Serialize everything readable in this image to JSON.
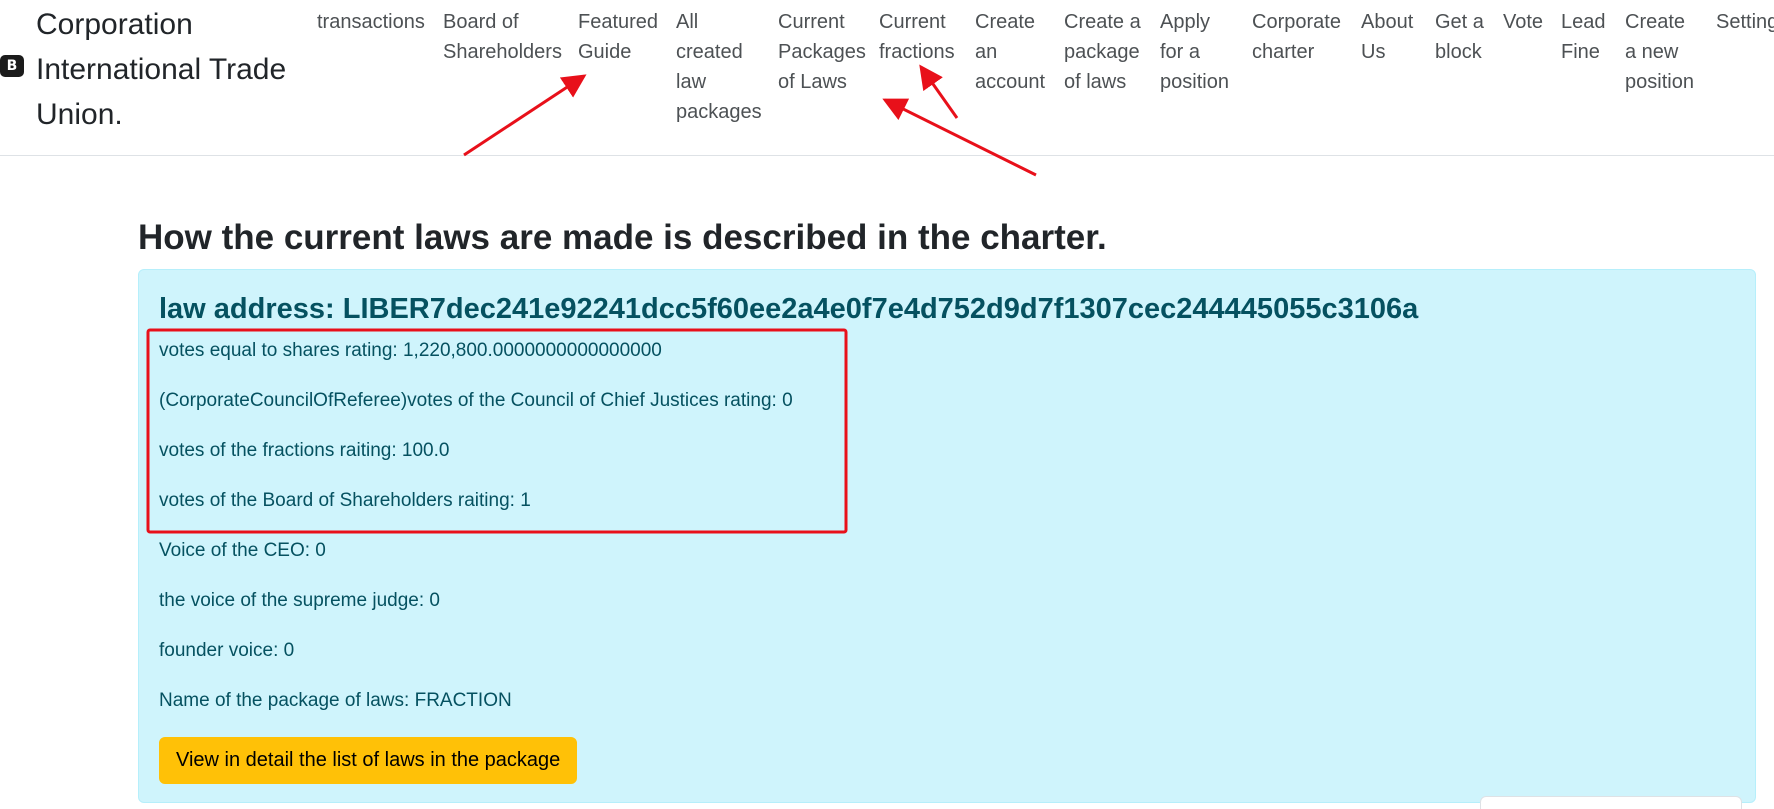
{
  "navbar": {
    "brand_icon": "B",
    "brand_line1": "Corporation",
    "brand_line2": "International Trade",
    "brand_line3": "Union.",
    "items": [
      {
        "lines": [
          "transactions"
        ]
      },
      {
        "lines": [
          "Board of",
          "Shareholders"
        ]
      },
      {
        "lines": [
          "Featured",
          "Guide"
        ]
      },
      {
        "lines": [
          "All",
          "created",
          "law",
          "packages"
        ]
      },
      {
        "lines": [
          "Current",
          "Packages",
          "of Laws"
        ]
      },
      {
        "lines": [
          "Current",
          "fractions"
        ]
      },
      {
        "lines": [
          "Create",
          "an",
          "account"
        ]
      },
      {
        "lines": [
          "Create a",
          "package",
          "of laws"
        ]
      },
      {
        "lines": [
          "Apply",
          "for a",
          "position"
        ]
      },
      {
        "lines": [
          "Corporate",
          "charter"
        ]
      },
      {
        "lines": [
          "About",
          "Us"
        ]
      },
      {
        "lines": [
          "Get a",
          "block"
        ]
      },
      {
        "lines": [
          "Vote"
        ]
      },
      {
        "lines": [
          "Lead",
          "Fine"
        ]
      },
      {
        "lines": [
          "Create",
          "a new",
          "position"
        ]
      },
      {
        "lines": [
          "Settings"
        ]
      }
    ]
  },
  "main": {
    "heading": "How the current laws are made is described in the charter.",
    "law_card": {
      "address": "law address: LIBER7dec241e92241dcc5f60ee2a4e0f7e4d752d9d7f1307cec244445055c3106a",
      "votes_shares": "votes equal to shares rating: 1,220,800.0000000000000000",
      "votes_council": "(CorporateCouncilOfReferee)votes of the Council of Chief Justices rating: 0",
      "votes_fractions": "votes of the fractions raiting: 100.0",
      "votes_board": "votes of the Board of Shareholders raiting: 1",
      "voice_ceo": "Voice of the CEO: 0",
      "voice_judge": "the voice of the supreme judge: 0",
      "voice_founder": "founder voice: 0",
      "package_name": "Name of the package of laws: FRACTION",
      "view_button": "View in detail the list of laws in the package"
    }
  },
  "colors": {
    "card_background": "#cff4fc",
    "card_text": "#055160",
    "button_background": "#ffc107",
    "annotation_red": "#e8101a"
  }
}
